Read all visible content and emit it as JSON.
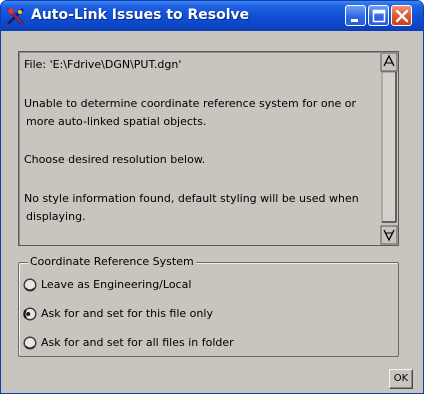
{
  "window": {
    "title": "Auto-Link Issues to Resolve",
    "colors": {
      "titlebar": "#0f4fd4",
      "body": "#c8c4be",
      "close": "#e0542e"
    },
    "icons": {
      "app": "app-logo-icon",
      "minimize": "minimize-icon",
      "maximize": "maximize-icon",
      "close": "close-icon"
    }
  },
  "message": {
    "lines": [
      "File: 'E:\\Fdrive\\DGN\\PUT.dgn'",
      "Unable to determine coordinate reference system for one or",
      "more auto-linked spatial objects.",
      "Choose desired resolution below.",
      "No style information found, default styling will be used when",
      "displaying."
    ]
  },
  "crs_group": {
    "legend": "Coordinate Reference System",
    "options": [
      {
        "label": "Leave as Engineering/Local",
        "selected": false
      },
      {
        "label": "Ask for and set for this file only",
        "selected": true
      },
      {
        "label": "Ask for and set for all files in folder",
        "selected": false
      }
    ]
  },
  "buttons": {
    "ok": "OK"
  }
}
